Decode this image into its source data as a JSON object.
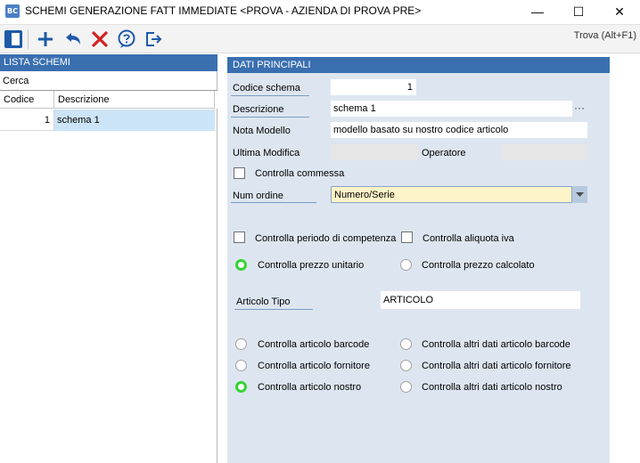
{
  "window": {
    "icon_text": "BC",
    "title": "SCHEMI GENERAZIONE FATT IMMEDIATE <PROVA - AZIENDA DI PROVA PRE>",
    "minimize": "—",
    "maximize": "☐",
    "close": "✕"
  },
  "toolbar": {
    "find_label": "Trova (Alt+F1)"
  },
  "list": {
    "header": "LISTA SCHEMI",
    "search_label": "Cerca",
    "search_value": "",
    "columns": [
      "Codice",
      "Descrizione"
    ],
    "rows": [
      {
        "code": "1",
        "description": "schema 1"
      }
    ]
  },
  "form": {
    "header": "DATI PRINCIPALI",
    "codice_schema": {
      "label": "Codice schema",
      "value": "1"
    },
    "descrizione": {
      "label": "Descrizione",
      "value": "schema 1",
      "lookup": "···"
    },
    "nota_modello": {
      "label": "Nota Modello",
      "value": "modello basato su nostro codice articolo"
    },
    "ultima_modifica": {
      "label": "Ultima Modifica",
      "value": ""
    },
    "operatore": {
      "label": "Operatore",
      "value": ""
    },
    "controlla_commessa": {
      "label": "Controlla commessa",
      "checked": false
    },
    "num_ordine": {
      "label": "Num ordine",
      "value": "Numero/Serie"
    },
    "controlla_periodo": {
      "label": "Controlla periodo di competenza",
      "checked": false
    },
    "controlla_aliquota": {
      "label": "Controlla aliquota iva",
      "checked": false
    },
    "prezzo": {
      "unitario": {
        "label": "Controlla  prezzo unitario",
        "selected": true
      },
      "calcolato": {
        "label": "Controlla prezzo calcolato",
        "selected": false
      }
    },
    "articolo_tipo": {
      "label": "Articolo Tipo",
      "value": "ARTICOLO"
    },
    "articolo_options": [
      {
        "label": "Controlla articolo barcode",
        "selected": false
      },
      {
        "label": "Controlla articolo fornitore",
        "selected": false
      },
      {
        "label": "Controlla articolo nostro",
        "selected": true
      }
    ],
    "altri_dati_options": [
      {
        "label": "Controlla altri dati articolo barcode",
        "selected": false
      },
      {
        "label": "Controlla altri dati  articolo fornitore",
        "selected": false
      },
      {
        "label": "Controlla altri dati articolo nostro",
        "selected": false
      }
    ]
  },
  "colors": {
    "header_blue": "#3a6fb0",
    "form_bg": "#dde6f0",
    "selected_row": "#cce4f7",
    "highlight_field": "#fdf5c8",
    "radio_on": "#34d334",
    "icon_blue": "#1e5aa8",
    "icon_red": "#d42020"
  }
}
